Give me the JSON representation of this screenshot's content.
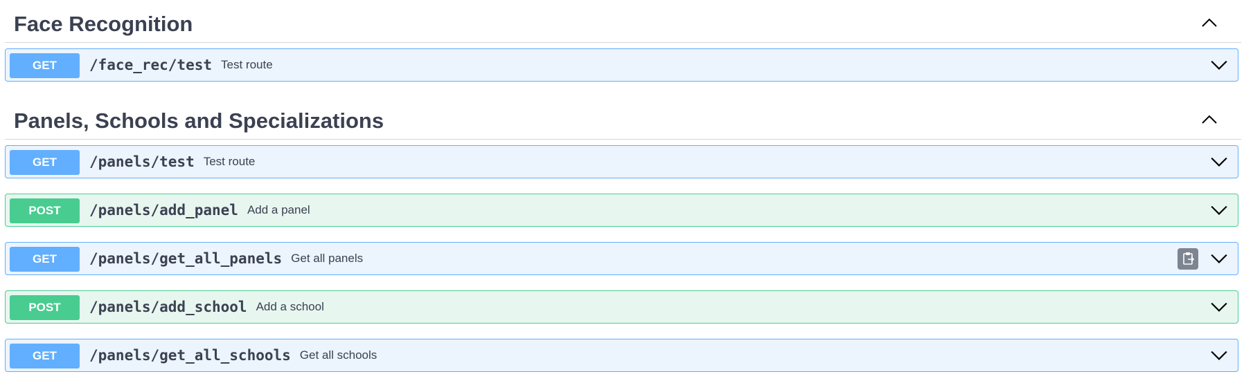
{
  "sections": [
    {
      "title": "Face Recognition",
      "toggle_icon": "chevron-up-icon",
      "operations": [
        {
          "method": "GET",
          "path": "/face_rec/test",
          "summary": "Test route"
        }
      ]
    },
    {
      "title": "Panels, Schools and Specializations",
      "toggle_icon": "chevron-up-icon",
      "operations": [
        {
          "method": "GET",
          "path": "/panels/test",
          "summary": "Test route"
        },
        {
          "method": "POST",
          "path": "/panels/add_panel",
          "summary": "Add a panel"
        },
        {
          "method": "GET",
          "path": "/panels/get_all_panels",
          "summary": "Get all panels",
          "copy_icon": "clipboard-copy-icon"
        },
        {
          "method": "POST",
          "path": "/panels/add_school",
          "summary": "Add a school"
        },
        {
          "method": "GET",
          "path": "/panels/get_all_schools",
          "summary": "Get all schools"
        }
      ]
    }
  ],
  "colors": {
    "get_border": "#61affe",
    "get_bg": "#ecf4fd",
    "post_border": "#49cc90",
    "post_bg": "#e8f6f0",
    "text": "#3b4151",
    "copy_button": "#7d8492"
  }
}
